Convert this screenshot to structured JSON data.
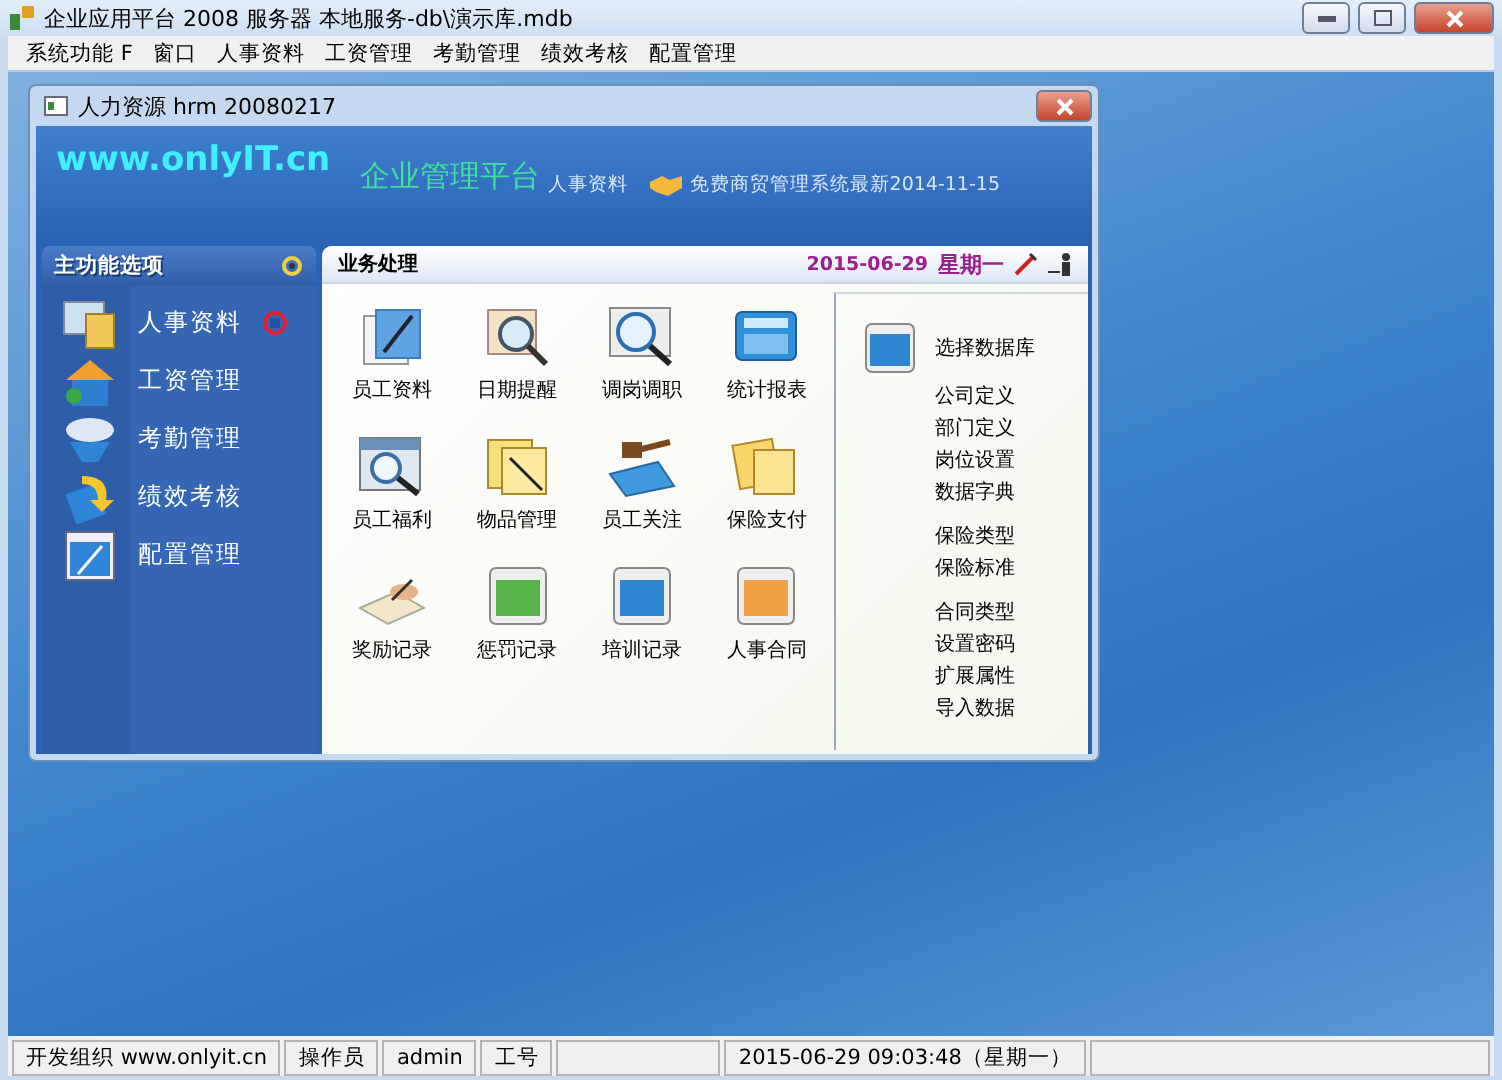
{
  "window": {
    "title": "企业应用平台 2008 服务器 本地服务-db\\演示库.mdb"
  },
  "menu": [
    "系统功能 F",
    "窗口",
    "人事资料",
    "工资管理",
    "考勤管理",
    "绩效考核",
    "配置管理"
  ],
  "child_window": {
    "title": "人力资源 hrm 20080217",
    "banner": {
      "site": "www.onlyIT.cn",
      "platform": "企业管理平台",
      "module": "人事资料",
      "news": "免费商贸管理系统最新2014-11-15"
    },
    "sidebar": {
      "title": "主功能选项",
      "items": [
        {
          "label": "人事资料",
          "selected": true
        },
        {
          "label": "工资管理",
          "selected": false
        },
        {
          "label": "考勤管理",
          "selected": false
        },
        {
          "label": "绩效考核",
          "selected": false
        },
        {
          "label": "配置管理",
          "selected": false
        }
      ]
    },
    "panel": {
      "title": "业务处理",
      "date": "2015-06-29",
      "weekday": "星期一",
      "tiles": [
        "员工资料",
        "日期提醒",
        "调岗调职",
        "统计报表",
        "员工福利",
        "物品管理",
        "员工关注",
        "保险支付",
        "奖励记录",
        "惩罚记录",
        "培训记录",
        "人事合同"
      ],
      "settings": {
        "title": "选择数据库",
        "groups": [
          [
            "公司定义",
            "部门定义",
            "岗位设置",
            "数据字典"
          ],
          [
            "保险类型",
            "保险标准"
          ],
          [
            "合同类型",
            "设置密码",
            "扩展属性",
            "导入数据"
          ]
        ]
      }
    }
  },
  "status_bar": [
    "开发组织 www.onlyit.cn",
    "操作员",
    "admin",
    "工号",
    "2015-06-29 09:03:48（星期一）"
  ]
}
